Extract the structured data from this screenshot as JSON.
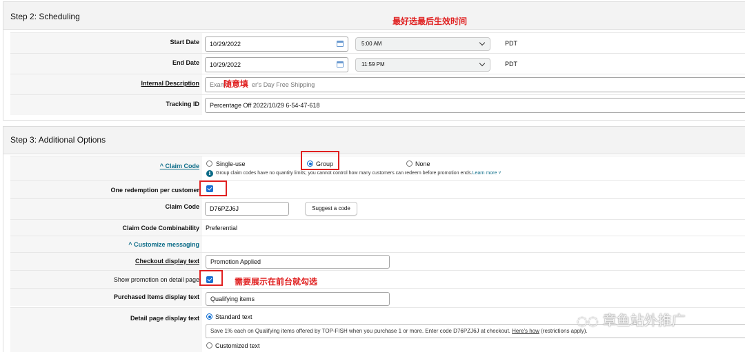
{
  "step2": {
    "title": "Step 2: Scheduling",
    "start_date": {
      "label": "Start Date",
      "date": "10/29/2022",
      "time": "5:00 AM",
      "tz": "PDT"
    },
    "end_date": {
      "label": "End Date",
      "date": "10/29/2022",
      "time": "11:59 PM",
      "tz": "PDT"
    },
    "internal_description": {
      "label": "Internal Description",
      "placeholder": "Example: Father's Day Free Shipping",
      "placeholder_left": "Exam",
      "placeholder_right": "er's Day Free Shipping"
    },
    "tracking_id": {
      "label": "Tracking ID",
      "value": "Percentage Off 2022/10/29 6-54-47-618"
    }
  },
  "step3": {
    "title": "Step 3: Additional Options",
    "claim_code": {
      "label": "^ Claim Code",
      "options": [
        "Single-use",
        "Group",
        "None"
      ],
      "selected": "Group",
      "note": "Group claim codes have no quantity limits; you cannot control how many customers can redeem before promotion ends.",
      "learn_more": "Learn more ˅"
    },
    "one_redemption": {
      "label": "One redemption per customer",
      "checked": true
    },
    "claim_code_value": {
      "label": "Claim Code",
      "value": "D76PZJ6J",
      "suggest_button": "Suggest a code"
    },
    "combinability": {
      "label": "Claim Code Combinability",
      "value": "Preferential"
    },
    "customize_messaging": {
      "label": "^ Customize messaging"
    },
    "checkout_display": {
      "label": "Checkout display text",
      "value": "Promotion Applied"
    },
    "show_promotion": {
      "label": "Show promotion on detail page",
      "checked": true
    },
    "purchased_items": {
      "label": "Purchased Items display text",
      "value": "Qualifying items"
    },
    "detail_page_display": {
      "label": "Detail page display text",
      "standard_label": "Standard text",
      "customized_label": "Customized text",
      "standard_text_before": "Save 1% each on Qualifying items offered by TOP-FISH when you purchase 1 or more. Enter code D76PZJ6J at checkout. ",
      "standard_text_link": "Here's how",
      "standard_text_after": " (restrictions apply)."
    }
  },
  "annotations": {
    "last_effective_time": "最好选最后生效时间",
    "fill_anything": "随意填",
    "show_on_frontend": "需要展示在前台就勾选"
  },
  "watermark": "章鱼站外推广",
  "colors": {
    "accent_blue": "#1a6fd0",
    "link_teal": "#0a6b87",
    "annotation_red": "#e02020"
  }
}
